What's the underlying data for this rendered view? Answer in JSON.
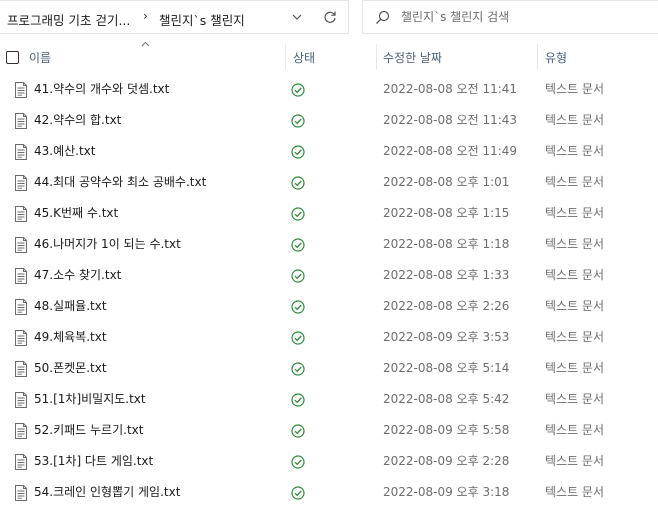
{
  "address_bar": {
    "crumbs": [
      "프로그래밍 기초 걷기...",
      "챌린지`s 챌린지"
    ],
    "separator": "›"
  },
  "search": {
    "placeholder": "챌린지`s 챌린지 검색"
  },
  "columns": {
    "name": "이름",
    "status": "상태",
    "modified": "수정한 날짜",
    "type": "유형"
  },
  "colors": {
    "status_ok": "#2f8a3b",
    "header_text": "#4c607a",
    "muted_text": "#6d6d6d"
  },
  "files": [
    {
      "name": "41.약수의 개수와 덧셈.txt",
      "modified": "2022-08-08 오전 11:41",
      "type": "텍스트 문서",
      "status": "check-circle-icon"
    },
    {
      "name": "42.약수의 합.txt",
      "modified": "2022-08-08 오전 11:43",
      "type": "텍스트 문서",
      "status": "check-circle-icon"
    },
    {
      "name": "43.예산.txt",
      "modified": "2022-08-08 오전 11:49",
      "type": "텍스트 문서",
      "status": "check-circle-icon"
    },
    {
      "name": "44.최대 공약수와 최소 공배수.txt",
      "modified": "2022-08-08 오후 1:01",
      "type": "텍스트 문서",
      "status": "check-circle-icon"
    },
    {
      "name": "45.K번째 수.txt",
      "modified": "2022-08-08 오후 1:15",
      "type": "텍스트 문서",
      "status": "check-circle-icon"
    },
    {
      "name": "46.나머지가 1이 되는 수.txt",
      "modified": "2022-08-08 오후 1:18",
      "type": "텍스트 문서",
      "status": "check-circle-icon"
    },
    {
      "name": "47.소수 찾기.txt",
      "modified": "2022-08-08 오후 1:33",
      "type": "텍스트 문서",
      "status": "check-circle-icon"
    },
    {
      "name": "48.실패율.txt",
      "modified": "2022-08-08 오후 2:26",
      "type": "텍스트 문서",
      "status": "check-circle-icon"
    },
    {
      "name": "49.체육복.txt",
      "modified": "2022-08-09 오후 3:53",
      "type": "텍스트 문서",
      "status": "check-circle-icon"
    },
    {
      "name": "50.폰켓몬.txt",
      "modified": "2022-08-08 오후 5:14",
      "type": "텍스트 문서",
      "status": "check-circle-icon"
    },
    {
      "name": "51.[1차]비밀지도.txt",
      "modified": "2022-08-08 오후 5:42",
      "type": "텍스트 문서",
      "status": "check-circle-icon"
    },
    {
      "name": "52.키패드 누르기.txt",
      "modified": "2022-08-09 오후 5:58",
      "type": "텍스트 문서",
      "status": "check-circle-icon"
    },
    {
      "name": "53.[1차] 다트 게임.txt",
      "modified": "2022-08-09 오후 2:28",
      "type": "텍스트 문서",
      "status": "check-circle-icon"
    },
    {
      "name": "54.크레인 인형뽑기 게임.txt",
      "modified": "2022-08-09 오후 3:18",
      "type": "텍스트 문서",
      "status": "check-circle-icon"
    }
  ]
}
